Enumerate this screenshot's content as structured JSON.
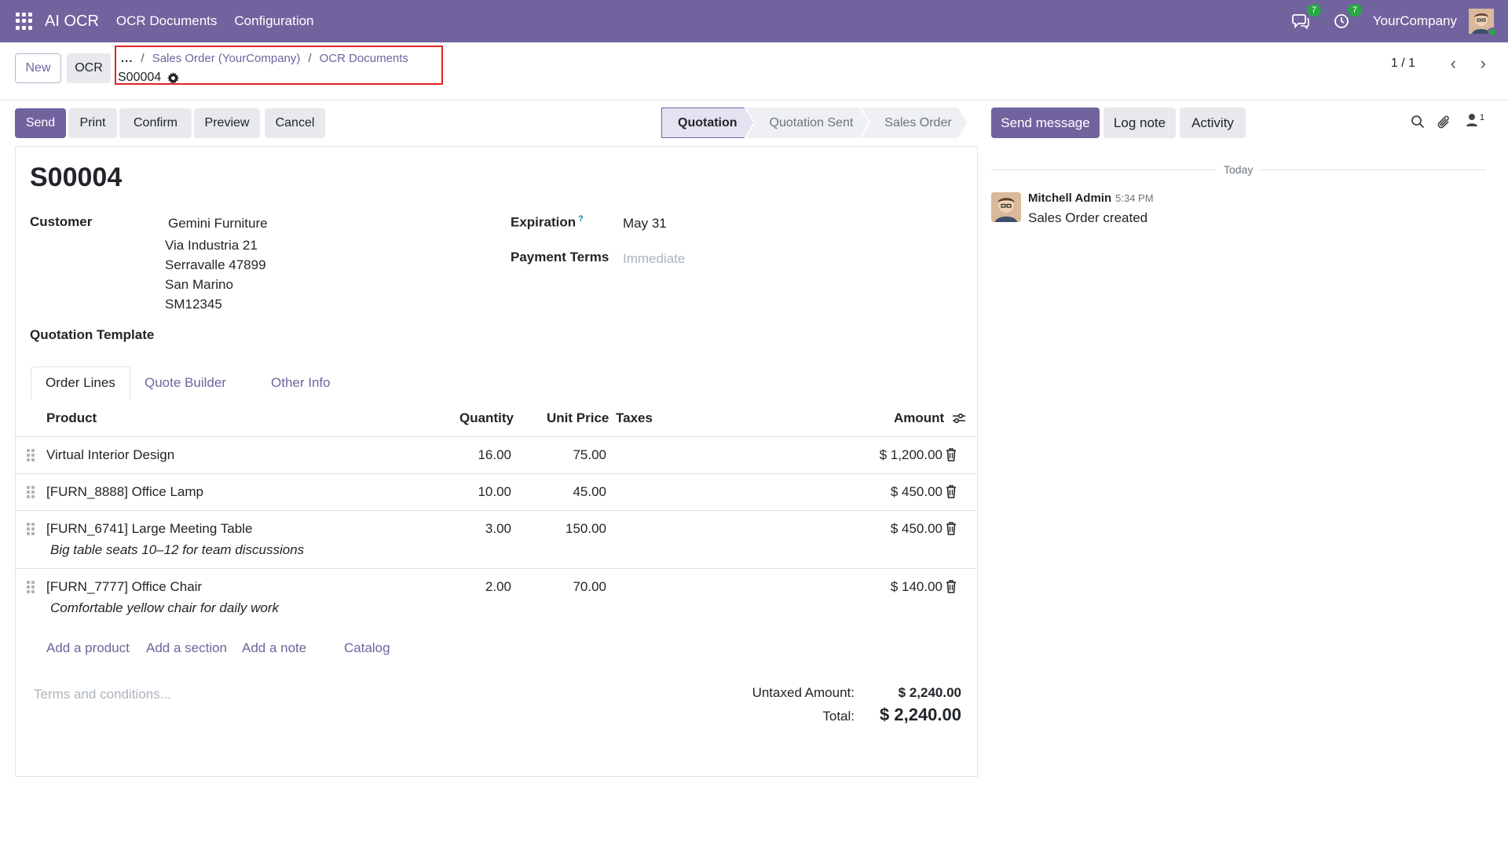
{
  "navbar": {
    "app_name": "AI OCR",
    "menus": [
      "OCR Documents",
      "Configuration"
    ],
    "messages_count": "7",
    "activities_count": "7",
    "company": "YourCompany"
  },
  "control": {
    "new_label": "New",
    "ocr_label": "OCR",
    "breadcrumb_dots": "...",
    "breadcrumb": [
      "Sales Order (YourCompany)",
      "OCR Documents"
    ],
    "record": "S00004",
    "pager": "1 / 1"
  },
  "actions": {
    "send": "Send",
    "print": "Print",
    "confirm": "Confirm",
    "preview": "Preview",
    "cancel": "Cancel"
  },
  "stages": [
    "Quotation",
    "Quotation Sent",
    "Sales Order"
  ],
  "form": {
    "title": "S00004",
    "customer_label": "Customer",
    "customer_name": "Gemini Furniture",
    "address": [
      "Via Industria 21",
      "Serravalle 47899",
      "San Marino",
      "SM12345"
    ],
    "expiration_label": "Expiration",
    "expiration_help": "?",
    "expiration": "May 31",
    "payment_terms_label": "Payment Terms",
    "payment_terms_placeholder": "Immediate",
    "template_label": "Quotation Template"
  },
  "tabs": [
    "Order Lines",
    "Quote Builder",
    "Other Info"
  ],
  "table": {
    "headers": {
      "product": "Product",
      "quantity": "Quantity",
      "unit_price": "Unit Price",
      "taxes": "Taxes",
      "amount": "Amount"
    },
    "rows": [
      {
        "product": "Virtual Interior Design",
        "desc": "",
        "quantity": "16.00",
        "price": "75.00",
        "amount": "$ 1,200.00"
      },
      {
        "product": "[FURN_8888] Office Lamp",
        "desc": "",
        "quantity": "10.00",
        "price": "45.00",
        "amount": "$ 450.00"
      },
      {
        "product": "[FURN_6741] Large Meeting Table",
        "desc": "Big table seats 10–12 for team discussions",
        "quantity": "3.00",
        "price": "150.00",
        "amount": "$ 450.00"
      },
      {
        "product": "[FURN_7777] Office Chair",
        "desc": "Comfortable yellow chair for daily work",
        "quantity": "2.00",
        "price": "70.00",
        "amount": "$ 140.00"
      }
    ],
    "add_links": [
      "Add a product",
      "Add a section",
      "Add a note",
      "Catalog"
    ]
  },
  "totals": {
    "terms_placeholder": "Terms and conditions...",
    "untaxed_label": "Untaxed Amount:",
    "untaxed": "$ 2,240.00",
    "total_label": "Total:",
    "total": "$ 2,240.00"
  },
  "chatter": {
    "send_message": "Send message",
    "log_note": "Log note",
    "activity": "Activity",
    "followers": "1",
    "today": "Today",
    "author": "Mitchell Admin",
    "time": "5:34 PM",
    "body": "Sales Order created"
  },
  "colors": {
    "brand": "#71639e",
    "badge": "#28a745",
    "highlight_box": "#e02424"
  }
}
